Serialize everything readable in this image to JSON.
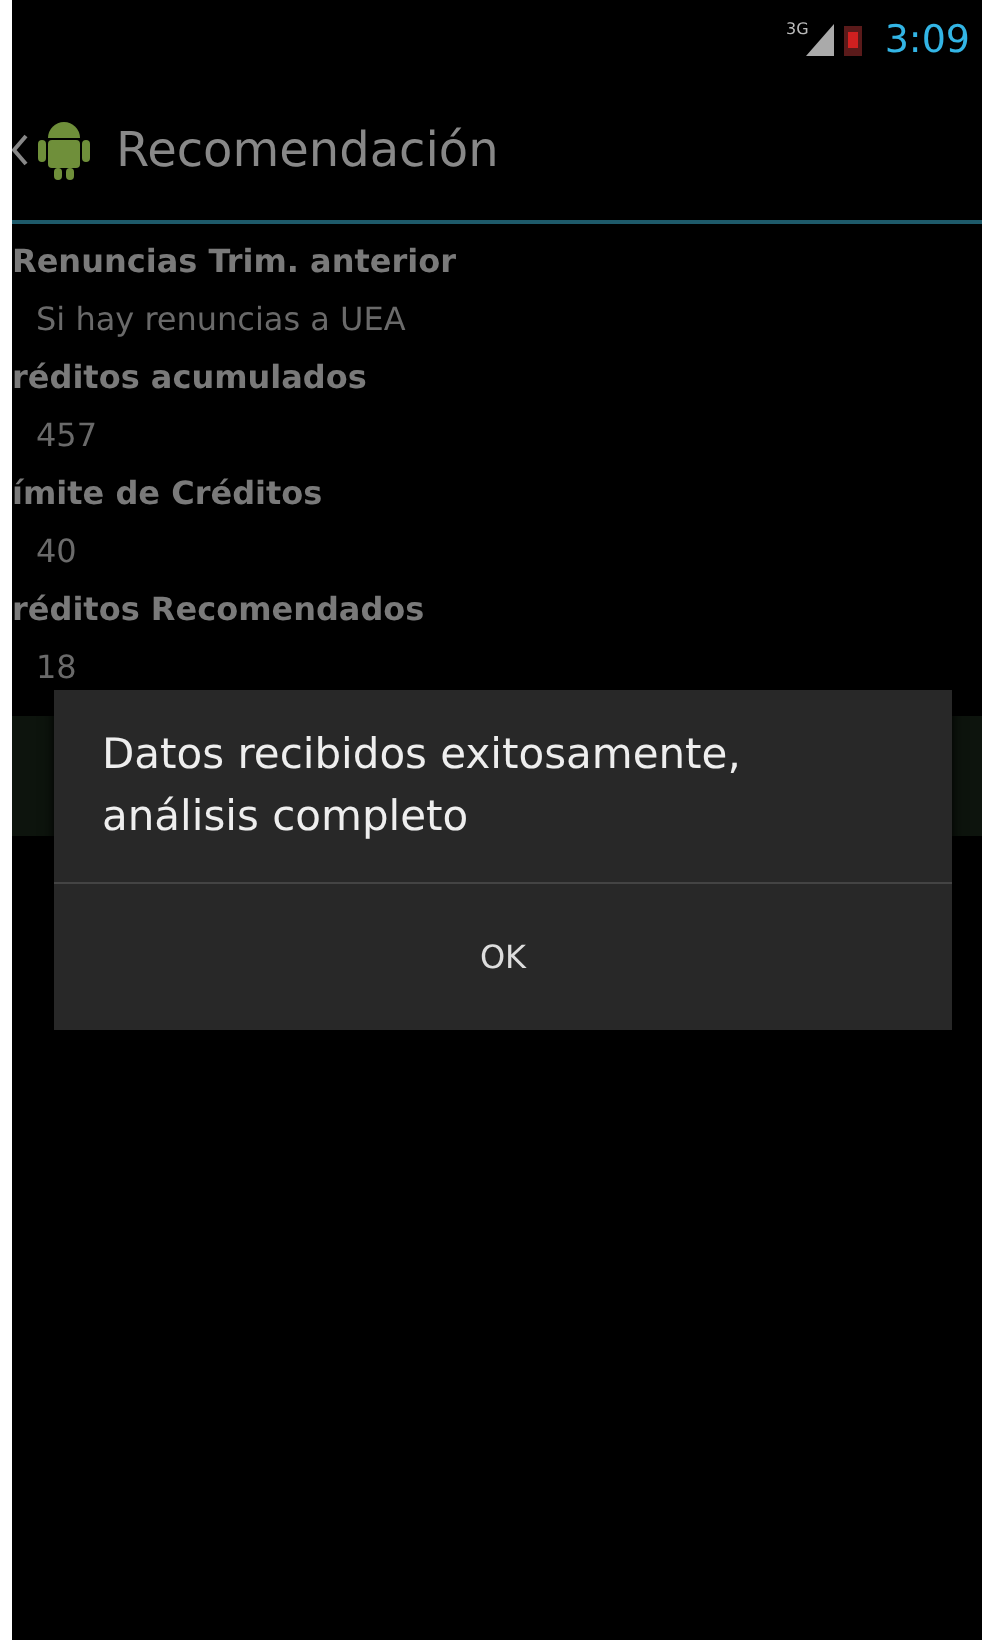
{
  "status_bar": {
    "network": "3G",
    "time": "3:09"
  },
  "action_bar": {
    "title": "Recomendación"
  },
  "fields": [
    {
      "label": "Renuncias Trim. anterior",
      "value": "Si hay renuncias a UEA"
    },
    {
      "label": "réditos acumulados",
      "value": "457"
    },
    {
      "label": "ímite de Créditos",
      "value": "40"
    },
    {
      "label": "réditos Recomendados",
      "value": "18"
    }
  ],
  "dialog": {
    "message": "Datos recibidos exitosamente, análisis completo",
    "buttons": [
      "OK"
    ]
  }
}
